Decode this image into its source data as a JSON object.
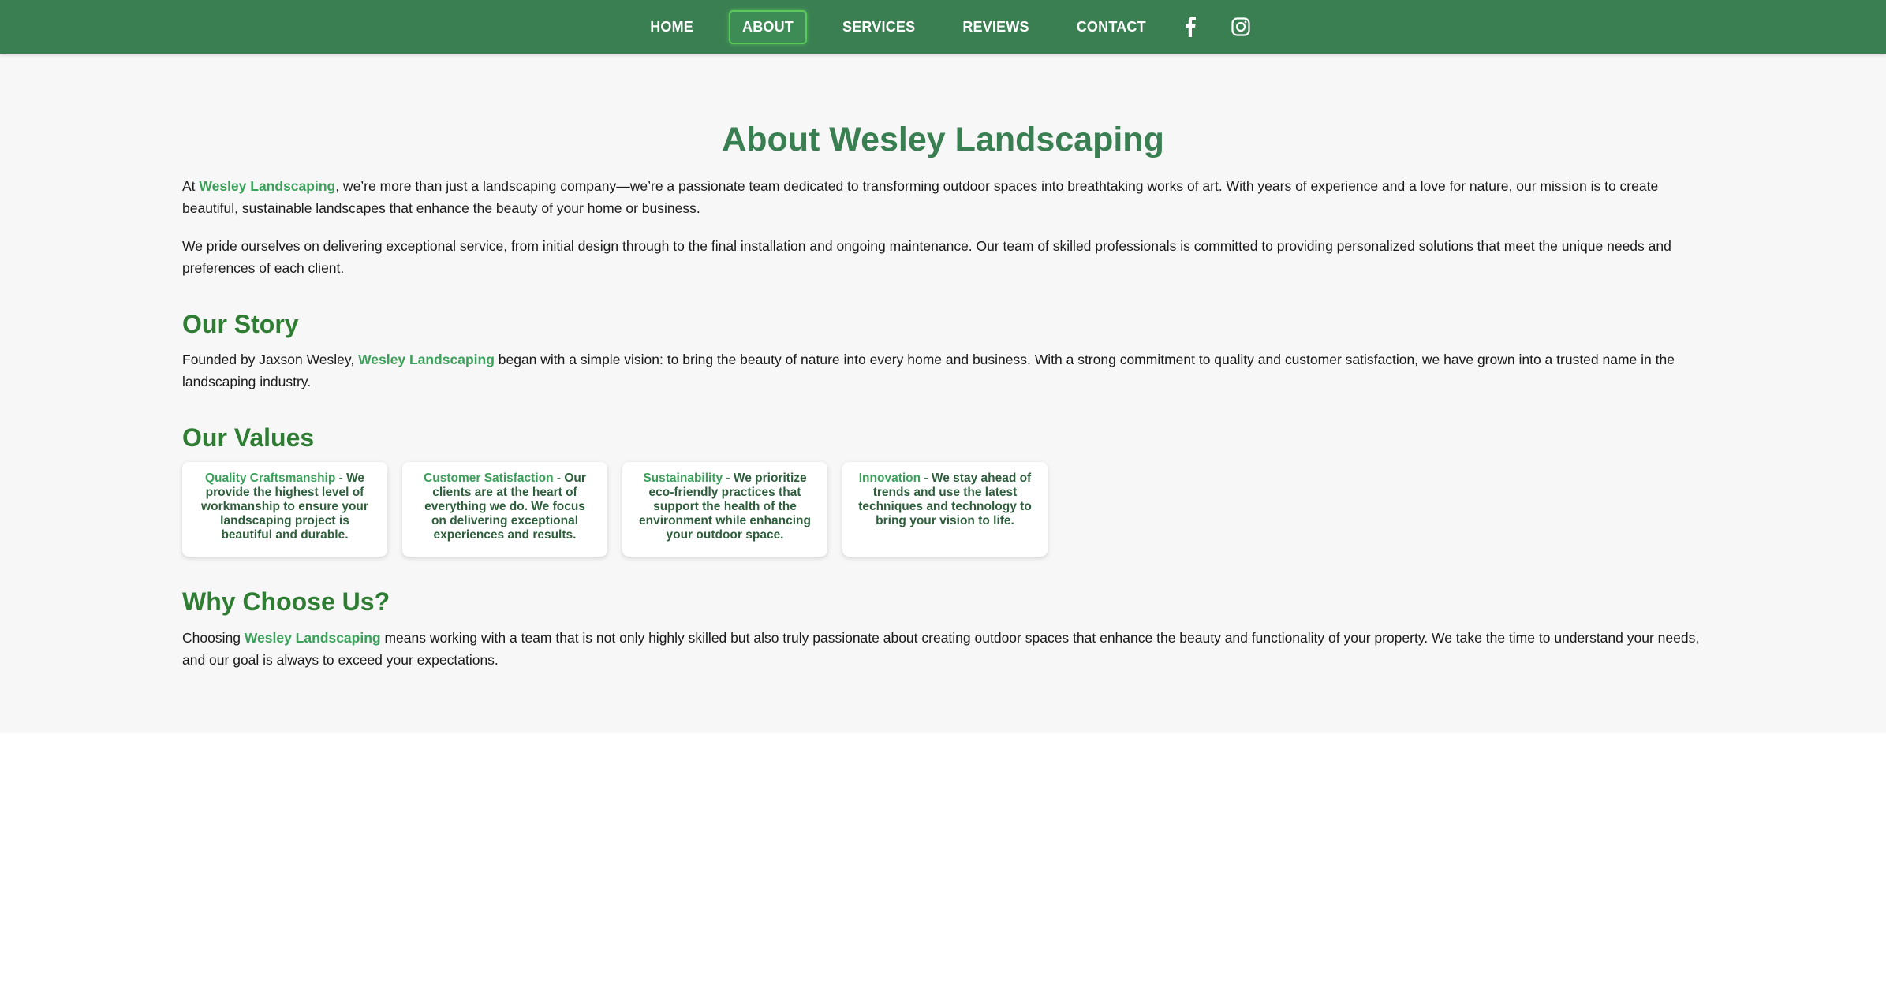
{
  "nav": {
    "links": [
      "HOME",
      "ABOUT",
      "SERVICES",
      "REVIEWS",
      "CONTACT"
    ],
    "active": "ABOUT",
    "social_icons": [
      "facebook-icon",
      "instagram-icon"
    ]
  },
  "colors": {
    "header_bg": "#3a7f52",
    "title": "#3a7f52",
    "section_heading": "#2e7d32",
    "brand_highlight": "#3aa05a",
    "page_bg": "#f7f7f7"
  },
  "page_title": "About Wesley Landscaping",
  "brand_name": "Wesley Landscaping",
  "intro": {
    "p1_before": "At ",
    "p1_after": ", we’re more than just a landscaping company—we’re a passionate team dedicated to transforming outdoor spaces into breathtaking works of art. With years of experience and a love for nature, our mission is to create beautiful, sustainable landscapes that enhance the beauty of your home or business.",
    "p2": "We pride ourselves on delivering exceptional service, from initial design through to the final installation and ongoing maintenance. Our team of skilled professionals is committed to providing personalized solutions that meet the unique needs and preferences of each client."
  },
  "story": {
    "heading": "Our Story",
    "before": "Founded by Jaxson Wesley, ",
    "after": " began with a simple vision: to bring the beauty of nature into every home and business. With a strong commitment to quality and customer satisfaction, we have grown into a trusted name in the landscaping industry."
  },
  "values": {
    "heading": "Our Values",
    "items": [
      {
        "name": "Quality Craftsmanship",
        "desc": " - We provide the highest level of workmanship to ensure your landscaping project is beautiful and durable."
      },
      {
        "name": "Customer Satisfaction",
        "desc": " - Our clients are at the heart of everything we do. We focus on delivering exceptional experiences and results."
      },
      {
        "name": "Sustainability",
        "desc": " - We prioritize eco-friendly practices that support the health of the environment while enhancing your outdoor space."
      },
      {
        "name": "Innovation",
        "desc": " - We stay ahead of trends and use the latest techniques and technology to bring your vision to life."
      }
    ]
  },
  "why": {
    "heading": "Why Choose Us?",
    "before": "Choosing ",
    "after": " means working with a team that is not only highly skilled but also truly passionate about creating outdoor spaces that enhance the beauty and functionality of your property. We take the time to understand your needs, and our goal is always to exceed your expectations."
  }
}
